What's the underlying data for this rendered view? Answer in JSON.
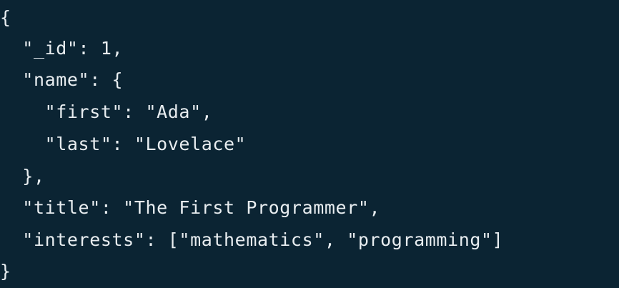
{
  "code": {
    "lines": [
      "{",
      "  \"_id\": 1,",
      "  \"name\": {",
      "    \"first\": \"Ada\",",
      "    \"last\": \"Lovelace\"",
      "  },",
      "  \"title\": \"The First Programmer\",",
      "  \"interests\": [\"mathematics\", \"programming\"]",
      "}"
    ]
  },
  "colors": {
    "background": "#0b2433",
    "text": "#e8edf0"
  }
}
